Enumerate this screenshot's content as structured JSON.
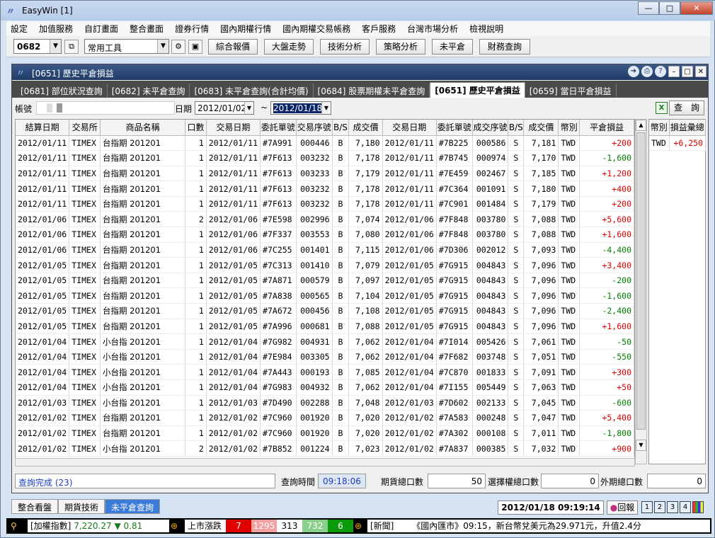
{
  "app": {
    "title": "EasyWin [1]"
  },
  "menu": [
    "設定",
    "加值服務",
    "自訂畫面",
    "整合畫面",
    "證券行情",
    "國內期權行情",
    "國內期權交易帳務",
    "客戶服務",
    "台灣市場分析",
    "檢視說明"
  ],
  "toolbar": {
    "code": "0682",
    "tools": "常用工具",
    "buttons": [
      "綜合報價",
      "大盤走勢",
      "技術分析",
      "策略分析",
      "未平倉",
      "財務查詢"
    ]
  },
  "child": {
    "title": "[0651] 歷史平倉損益",
    "tabs": [
      "[0681] 部位狀況查詢",
      "[0682] 未平倉查詢",
      "[0683] 未平倉查詢(合計均價)",
      "[0684] 股票期權未平倉查詢",
      "[0651] 歷史平倉損益",
      "[0659] 當日平倉損益"
    ],
    "active_tab": 4,
    "filter": {
      "account_label": "帳號",
      "date_label": "日期",
      "date_from": "2012/01/02",
      "tilde": "~",
      "date_to": "2012/01/18",
      "query": "查　詢"
    },
    "columns": [
      "結算日期",
      "交易所",
      "商品名稱",
      "口數",
      "交易日期",
      "委託單號",
      "交易序號",
      "B/S",
      "成交價",
      "交易日期",
      "委託單號",
      "成交序號",
      "B/S",
      "成交價",
      "幣別",
      "平倉損益"
    ],
    "rows": [
      [
        "2012/01/11",
        "TIMEX",
        "台指期 201201",
        "1",
        "2012/01/11",
        "#7A991",
        "000446",
        "B",
        "7,180",
        "2012/01/11",
        "#7B225",
        "000586",
        "S",
        "7,181",
        "TWD",
        "+200"
      ],
      [
        "2012/01/11",
        "TIMEX",
        "台指期 201201",
        "1",
        "2012/01/11",
        "#7F613",
        "003232",
        "B",
        "7,178",
        "2012/01/11",
        "#7B745",
        "000974",
        "S",
        "7,170",
        "TWD",
        "-1,600"
      ],
      [
        "2012/01/11",
        "TIMEX",
        "台指期 201201",
        "1",
        "2012/01/11",
        "#7F613",
        "003233",
        "B",
        "7,179",
        "2012/01/11",
        "#7E459",
        "002467",
        "S",
        "7,185",
        "TWD",
        "+1,200"
      ],
      [
        "2012/01/11",
        "TIMEX",
        "台指期 201201",
        "1",
        "2012/01/11",
        "#7F613",
        "003232",
        "B",
        "7,178",
        "2012/01/11",
        "#7C364",
        "001091",
        "S",
        "7,180",
        "TWD",
        "+400"
      ],
      [
        "2012/01/11",
        "TIMEX",
        "台指期 201201",
        "1",
        "2012/01/11",
        "#7F613",
        "003232",
        "B",
        "7,178",
        "2012/01/11",
        "#7C901",
        "001484",
        "S",
        "7,179",
        "TWD",
        "+200"
      ],
      [
        "2012/01/06",
        "TIMEX",
        "台指期 201201",
        "2",
        "2012/01/06",
        "#7E598",
        "002996",
        "B",
        "7,074",
        "2012/01/06",
        "#7F848",
        "003780",
        "S",
        "7,088",
        "TWD",
        "+5,600"
      ],
      [
        "2012/01/06",
        "TIMEX",
        "台指期 201201",
        "1",
        "2012/01/06",
        "#7F337",
        "003553",
        "B",
        "7,080",
        "2012/01/06",
        "#7F848",
        "003780",
        "S",
        "7,088",
        "TWD",
        "+1,600"
      ],
      [
        "2012/01/06",
        "TIMEX",
        "台指期 201201",
        "1",
        "2012/01/06",
        "#7C255",
        "001401",
        "B",
        "7,115",
        "2012/01/06",
        "#7D306",
        "002012",
        "S",
        "7,093",
        "TWD",
        "-4,400"
      ],
      [
        "2012/01/05",
        "TIMEX",
        "台指期 201201",
        "1",
        "2012/01/05",
        "#7C313",
        "001410",
        "B",
        "7,079",
        "2012/01/05",
        "#7G915",
        "004843",
        "S",
        "7,096",
        "TWD",
        "+3,400"
      ],
      [
        "2012/01/05",
        "TIMEX",
        "台指期 201201",
        "1",
        "2012/01/05",
        "#7A871",
        "000579",
        "B",
        "7,097",
        "2012/01/05",
        "#7G915",
        "004843",
        "S",
        "7,096",
        "TWD",
        "-200"
      ],
      [
        "2012/01/05",
        "TIMEX",
        "台指期 201201",
        "1",
        "2012/01/05",
        "#7A838",
        "000565",
        "B",
        "7,104",
        "2012/01/05",
        "#7G915",
        "004843",
        "S",
        "7,096",
        "TWD",
        "-1,600"
      ],
      [
        "2012/01/05",
        "TIMEX",
        "台指期 201201",
        "1",
        "2012/01/05",
        "#7A672",
        "000456",
        "B",
        "7,108",
        "2012/01/05",
        "#7G915",
        "004843",
        "S",
        "7,096",
        "TWD",
        "-2,400"
      ],
      [
        "2012/01/05",
        "TIMEX",
        "台指期 201201",
        "1",
        "2012/01/05",
        "#7A996",
        "000681",
        "B",
        "7,088",
        "2012/01/05",
        "#7G915",
        "004843",
        "S",
        "7,096",
        "TWD",
        "+1,600"
      ],
      [
        "2012/01/04",
        "TIMEX",
        "小台指 201201",
        "1",
        "2012/01/04",
        "#7G982",
        "004931",
        "B",
        "7,062",
        "2012/01/04",
        "#7I014",
        "005426",
        "S",
        "7,061",
        "TWD",
        "-50"
      ],
      [
        "2012/01/04",
        "TIMEX",
        "小台指 201201",
        "1",
        "2012/01/04",
        "#7E984",
        "003305",
        "B",
        "7,062",
        "2012/01/04",
        "#7F682",
        "003748",
        "S",
        "7,051",
        "TWD",
        "-550"
      ],
      [
        "2012/01/04",
        "TIMEX",
        "小台指 201201",
        "1",
        "2012/01/04",
        "#7A443",
        "000193",
        "B",
        "7,085",
        "2012/01/04",
        "#7C870",
        "001833",
        "S",
        "7,091",
        "TWD",
        "+300"
      ],
      [
        "2012/01/04",
        "TIMEX",
        "小台指 201201",
        "1",
        "2012/01/04",
        "#7G983",
        "004932",
        "B",
        "7,062",
        "2012/01/04",
        "#7I155",
        "005449",
        "S",
        "7,063",
        "TWD",
        "+50"
      ],
      [
        "2012/01/03",
        "TIMEX",
        "小台指 201201",
        "1",
        "2012/01/03",
        "#7D490",
        "002288",
        "B",
        "7,048",
        "2012/01/03",
        "#7D602",
        "002133",
        "S",
        "7,045",
        "TWD",
        "-600"
      ],
      [
        "2012/01/02",
        "TIMEX",
        "台指期 201201",
        "1",
        "2012/01/02",
        "#7C960",
        "001920",
        "B",
        "7,020",
        "2012/01/02",
        "#7A583",
        "000248",
        "S",
        "7,047",
        "TWD",
        "+5,400"
      ],
      [
        "2012/01/02",
        "TIMEX",
        "台指期 201201",
        "1",
        "2012/01/02",
        "#7C960",
        "001920",
        "B",
        "7,020",
        "2012/01/02",
        "#7A302",
        "000108",
        "S",
        "7,011",
        "TWD",
        "-1,800"
      ],
      [
        "2012/01/02",
        "TIMEX",
        "小台指 201201",
        "2",
        "2012/01/02",
        "#7B852",
        "001224",
        "B",
        "7,023",
        "2012/01/02",
        "#7A837",
        "000385",
        "S",
        "7,032",
        "TWD",
        "+900"
      ]
    ],
    "side": {
      "columns": [
        "幣別",
        "損益彙總"
      ],
      "rows": [
        [
          "TWD",
          "+6,250"
        ]
      ]
    },
    "status": {
      "done": "查詢完成 (23)",
      "time_label": "查詢時間",
      "time": "09:18:06",
      "fut_label": "期貨總口數",
      "fut": "50",
      "opt_label": "選擇權總口數",
      "opt": "0",
      "foreign_label": "外期總口數",
      "foreign": "0"
    }
  },
  "bottom": {
    "tabs": [
      "整合看盤",
      "期貨技術",
      "未平倉查詢"
    ],
    "active": 2,
    "clock": "2012/01/18 09:19:14",
    "huibao": "回報",
    "pages": [
      "1",
      "2",
      "3",
      "4"
    ]
  },
  "ticker": {
    "index_label": "[加權指數]",
    "index": "7,220.27",
    "change_arrow": "▼",
    "change": "0.81",
    "updown_label": "上市漲跌",
    "up_limit": "7",
    "up": "1295",
    "flat": "313",
    "down": "732",
    "down_limit": "6",
    "news_label": "[新聞]",
    "news": "《國內匯市》09:15，新台幣兌美元為29.971元，升值2.4分"
  },
  "colors": {
    "accent": "#1f3a66",
    "yellow": "#ffff00",
    "orange": "#ff9a1a",
    "pos": "#e00000",
    "neg": "#008000"
  }
}
